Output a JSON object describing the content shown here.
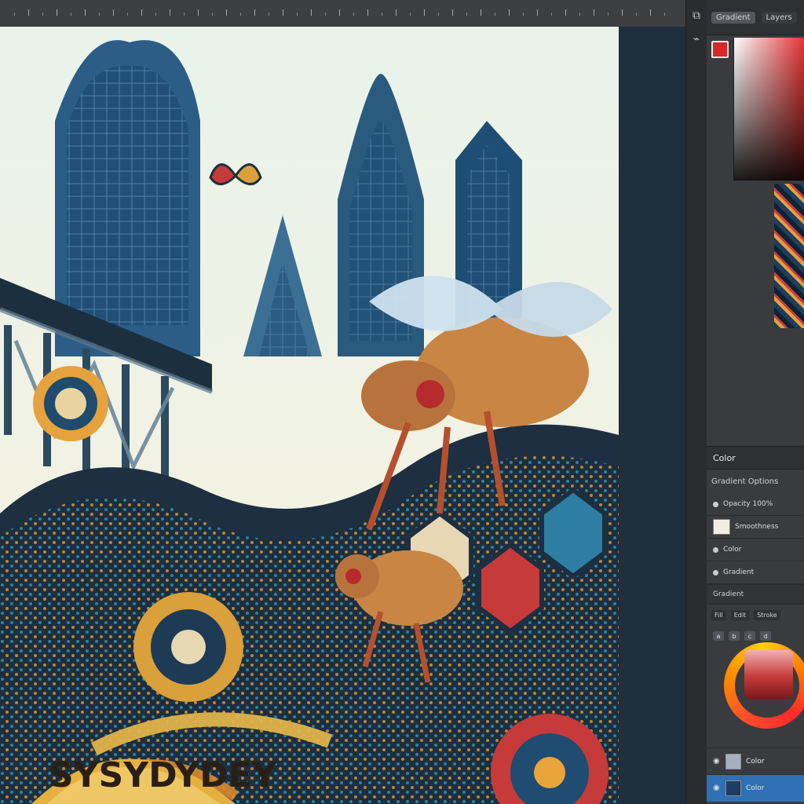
{
  "toolbar": {
    "tabs": [
      {
        "label": "Gradient"
      },
      {
        "label": "Layers"
      }
    ],
    "tool_icons": [
      "layers-icon",
      "brush-icon"
    ]
  },
  "canvas": {
    "artwork_text": "SYSYDYDEY"
  },
  "color_panel": {
    "title": "Color",
    "subtitle": "Gradient Options",
    "primary_color": "#d62828",
    "rows": [
      {
        "label": "Opacity 100%"
      },
      {
        "label": "Smoothness"
      },
      {
        "label": "Color"
      },
      {
        "label": "Gradient"
      }
    ],
    "section2_title": "Gradient",
    "mini_tabs": [
      {
        "label": "Fill"
      },
      {
        "label": "Edit"
      },
      {
        "label": "Stroke"
      }
    ],
    "mini_buttons": [
      "a",
      "b",
      "c",
      "d"
    ]
  },
  "layers": [
    {
      "label": "Color",
      "swatch": "#a7b0ba"
    },
    {
      "label": "Color",
      "swatch": "#1f3c63",
      "active": true
    }
  ]
}
